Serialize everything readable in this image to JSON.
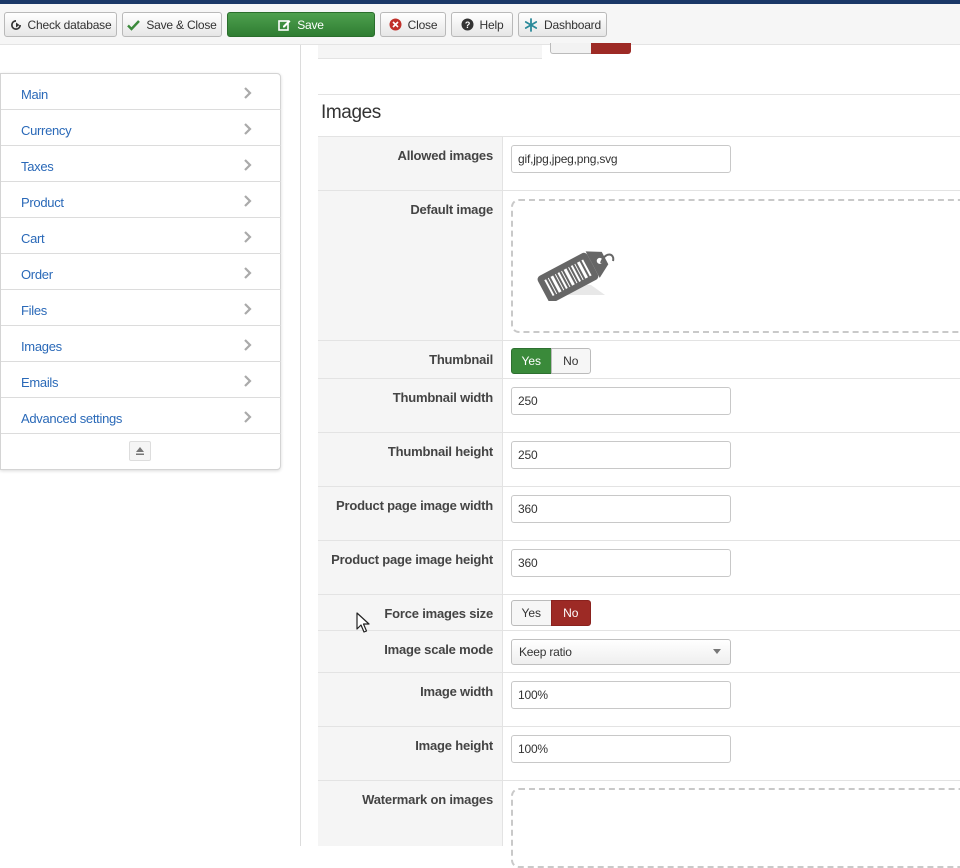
{
  "toolbar": {
    "check_database": "Check database",
    "save_close": "Save & Close",
    "save": "Save",
    "close": "Close",
    "help": "Help",
    "dashboard": "Dashboard"
  },
  "sidebar": {
    "items": [
      {
        "label": "Main"
      },
      {
        "label": "Currency"
      },
      {
        "label": "Taxes"
      },
      {
        "label": "Product"
      },
      {
        "label": "Cart"
      },
      {
        "label": "Order"
      },
      {
        "label": "Files"
      },
      {
        "label": "Images"
      },
      {
        "label": "Emails"
      },
      {
        "label": "Advanced settings"
      }
    ]
  },
  "section": {
    "title": "Images",
    "fields": {
      "allowed_images": {
        "label": "Allowed images",
        "value": "gif,jpg,jpeg,png,svg"
      },
      "default_image": {
        "label": "Default image"
      },
      "thumbnail": {
        "label": "Thumbnail",
        "yes": "Yes",
        "no": "No",
        "selected": "Yes"
      },
      "thumbnail_width": {
        "label": "Thumbnail width",
        "value": "250"
      },
      "thumbnail_height": {
        "label": "Thumbnail height",
        "value": "250"
      },
      "product_page_image_width": {
        "label": "Product page image width",
        "value": "360"
      },
      "product_page_image_height": {
        "label": "Product page image height",
        "value": "360"
      },
      "force_images_size": {
        "label": "Force images size",
        "yes": "Yes",
        "no": "No",
        "selected": "No"
      },
      "image_scale_mode": {
        "label": "Image scale mode",
        "value": "Keep ratio"
      },
      "image_width": {
        "label": "Image width",
        "value": "100%"
      },
      "image_height": {
        "label": "Image height",
        "value": "100%"
      },
      "watermark_on_images": {
        "label": "Watermark on images"
      }
    }
  },
  "colors": {
    "accent_green": "#3a8a3a",
    "accent_red": "#9d2a25",
    "link_blue": "#2a69b8",
    "topbar": "#1a3867"
  }
}
